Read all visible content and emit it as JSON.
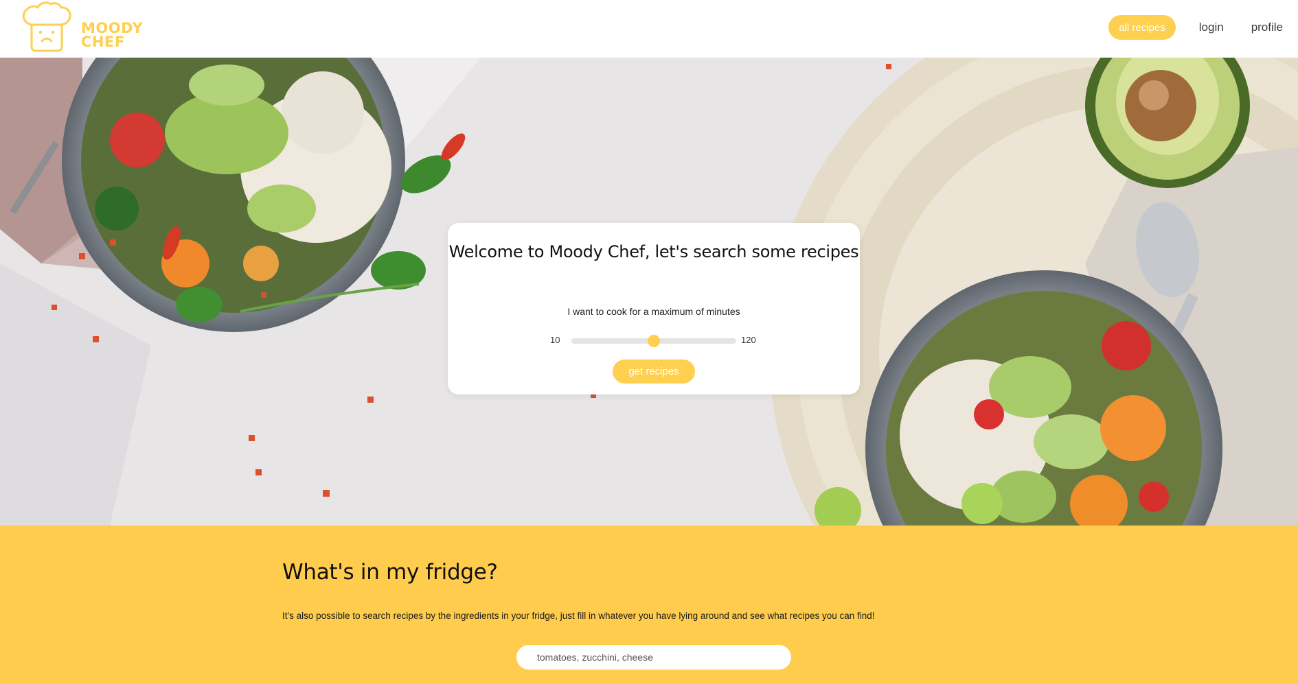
{
  "brand": {
    "name_line1": "MOODY",
    "name_line2": "CHEF",
    "logo_icon": "chef-hat-icon",
    "accent_color": "#ffcf4f"
  },
  "nav": {
    "all_recipes": "all recipes",
    "login": "login",
    "profile": "profile"
  },
  "hero": {
    "title": "Welcome to Moody Chef, let's search some recipes",
    "sentence": "I want to cook for a maximum of   minutes",
    "slider": {
      "min_label": "10",
      "max_label": "120",
      "min": 10,
      "max": 120,
      "value": 65
    },
    "button": "get recipes"
  },
  "fridge": {
    "title": "What's in my fridge?",
    "description": "It's also possible to search recipes by the ingredients in your fridge, just fill in whatever you have lying around and see what recipes you can find!",
    "input_placeholder": "tomatoes, zucchini, cheese",
    "background_color": "#ffcc4e"
  }
}
